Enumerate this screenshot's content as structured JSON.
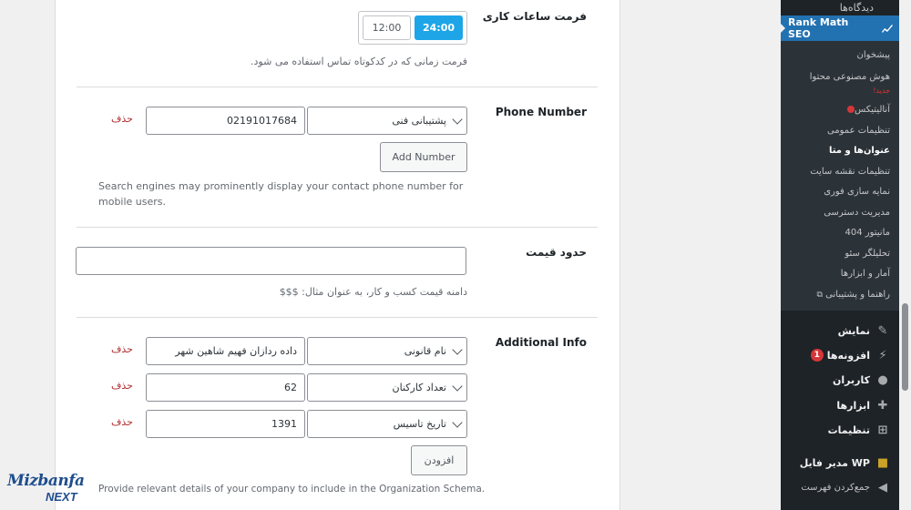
{
  "work_hours": {
    "label": "فرمت ساعات کاری",
    "option_24": "24:00",
    "option_12": "12:00",
    "description": "فرمت زمانی که در کدکوتاه تماس استفاده می شود."
  },
  "phone": {
    "label": "Phone Number",
    "type_selected": "پشتیبانی فنی",
    "number_value": "02191017684",
    "delete_label": "حذف",
    "add_button": "Add Number",
    "description": "Search engines may prominently display your contact phone number for mobile users."
  },
  "price": {
    "label": "حدود قیمت",
    "value": "",
    "description": "دامنه قیمت کسب و کار، به عنوان مثال: $$$"
  },
  "additional": {
    "label": "Additional Info",
    "rows": [
      {
        "type": "نام قانونی",
        "value": "داده ردازان فهیم شاهین شهر",
        "delete": "حذف"
      },
      {
        "type": "تعداد کارکنان",
        "value": "62",
        "delete": "حذف"
      },
      {
        "type": "تاریخ تاسیس",
        "value": "1391",
        "delete": "حذف"
      }
    ],
    "add_button": "افزودن",
    "description": "Provide relevant details of your company to include in the Organization Schema."
  },
  "sidebar": {
    "top_item": "دیدگاه‌ها",
    "active": "Rank Math SEO",
    "sub_items": [
      "پیشخوان",
      "هوش مصنوعی محتوا",
      "آنالیتیکس",
      "تنظیمات عمومی",
      "عنوان‌ها و متا",
      "تنظیمات نقشه سایت",
      "نمایه سازی فوری",
      "مدیریت دسترسی",
      "مانیتور 404",
      "تحلیلگر سئو",
      "آمار و ابزارها",
      "راهنما و پشتیبانی"
    ],
    "new_tag": "جدید!",
    "main_items": [
      "نمایش",
      "افزونه‌ها",
      "کاربران",
      "ابزارها",
      "تنظیمات",
      "WP مدیر فایل",
      "جمع‌کردن فهرست"
    ],
    "plugins_badge": "1"
  },
  "logo": {
    "line1": "Mizbanfa",
    "line2": "NEXT"
  },
  "colors": {
    "accent": "#1ea5e8",
    "admin_blue": "#2271b1",
    "delete_red": "#b32d2e",
    "sidebar_bg": "#1d2327"
  }
}
